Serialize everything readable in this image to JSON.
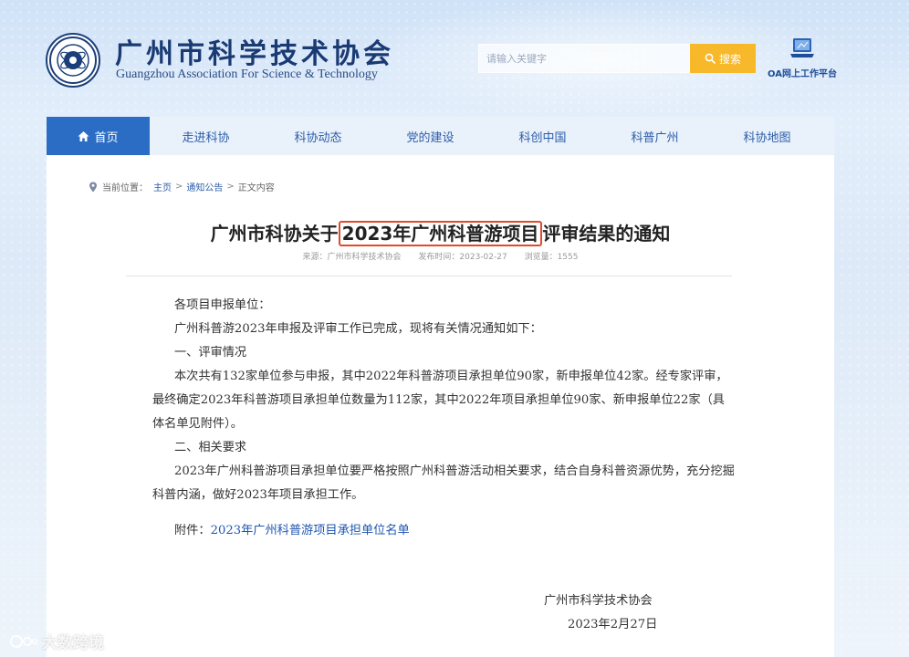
{
  "header": {
    "title": "广州市科学技术协会",
    "subtitle": "Guangzhou Association For Science & Technology",
    "logo_icon": "association-seal-icon"
  },
  "search": {
    "placeholder": "请输入关键字",
    "button_label": "搜索",
    "button_color": "#f7b82a"
  },
  "oa": {
    "label": "OA网上工作平台",
    "icon": "laptop-icon"
  },
  "nav": {
    "accent": "#2b6cc4",
    "items": [
      {
        "label": "首页",
        "active": true
      },
      {
        "label": "走进科协"
      },
      {
        "label": "科协动态"
      },
      {
        "label": "党的建设"
      },
      {
        "label": "科创中国"
      },
      {
        "label": "科普广州"
      },
      {
        "label": "科协地图"
      }
    ]
  },
  "breadcrumb": {
    "prefix": "当前位置：",
    "home": "主页",
    "sep": ">",
    "section": "通知公告",
    "current": "正文内容"
  },
  "article": {
    "title_before": "广州市科协关于",
    "title_highlight": "2023年广州科普游项目",
    "title_after": "评审结果的通知",
    "highlight_color": "#e04b2d",
    "source": "来源：广州市科学技术协会",
    "published": "发布时间：2023-02-27",
    "views": "浏览量：1555",
    "paragraphs": [
      "各项目申报单位：",
      "广州科普游2023年申报及评审工作已完成，现将有关情况通知如下：",
      "一、评审情况",
      "本次共有132家单位参与申报，其中2022年科普游项目承担单位90家，新申报单位42家。经专家评审，最终确定2023年科普游项目承担单位数量为112家，其中2022年项目承担单位90家、新申报单位22家（具体名单见附件）。",
      "二、相关要求",
      "2023年广州科普游项目承担单位要严格按照广州科普游活动相关要求，结合自身科普资源优势，充分挖掘科普内涵，做好2023年项目承担工作。"
    ],
    "attachment_label": "附件：",
    "attachment_link": "2023年广州科普游项目承担单位名单",
    "signature_org": "广州市科学技术协会",
    "signature_date": "2023年2月27日"
  },
  "watermark": {
    "text": "大数跨境"
  }
}
